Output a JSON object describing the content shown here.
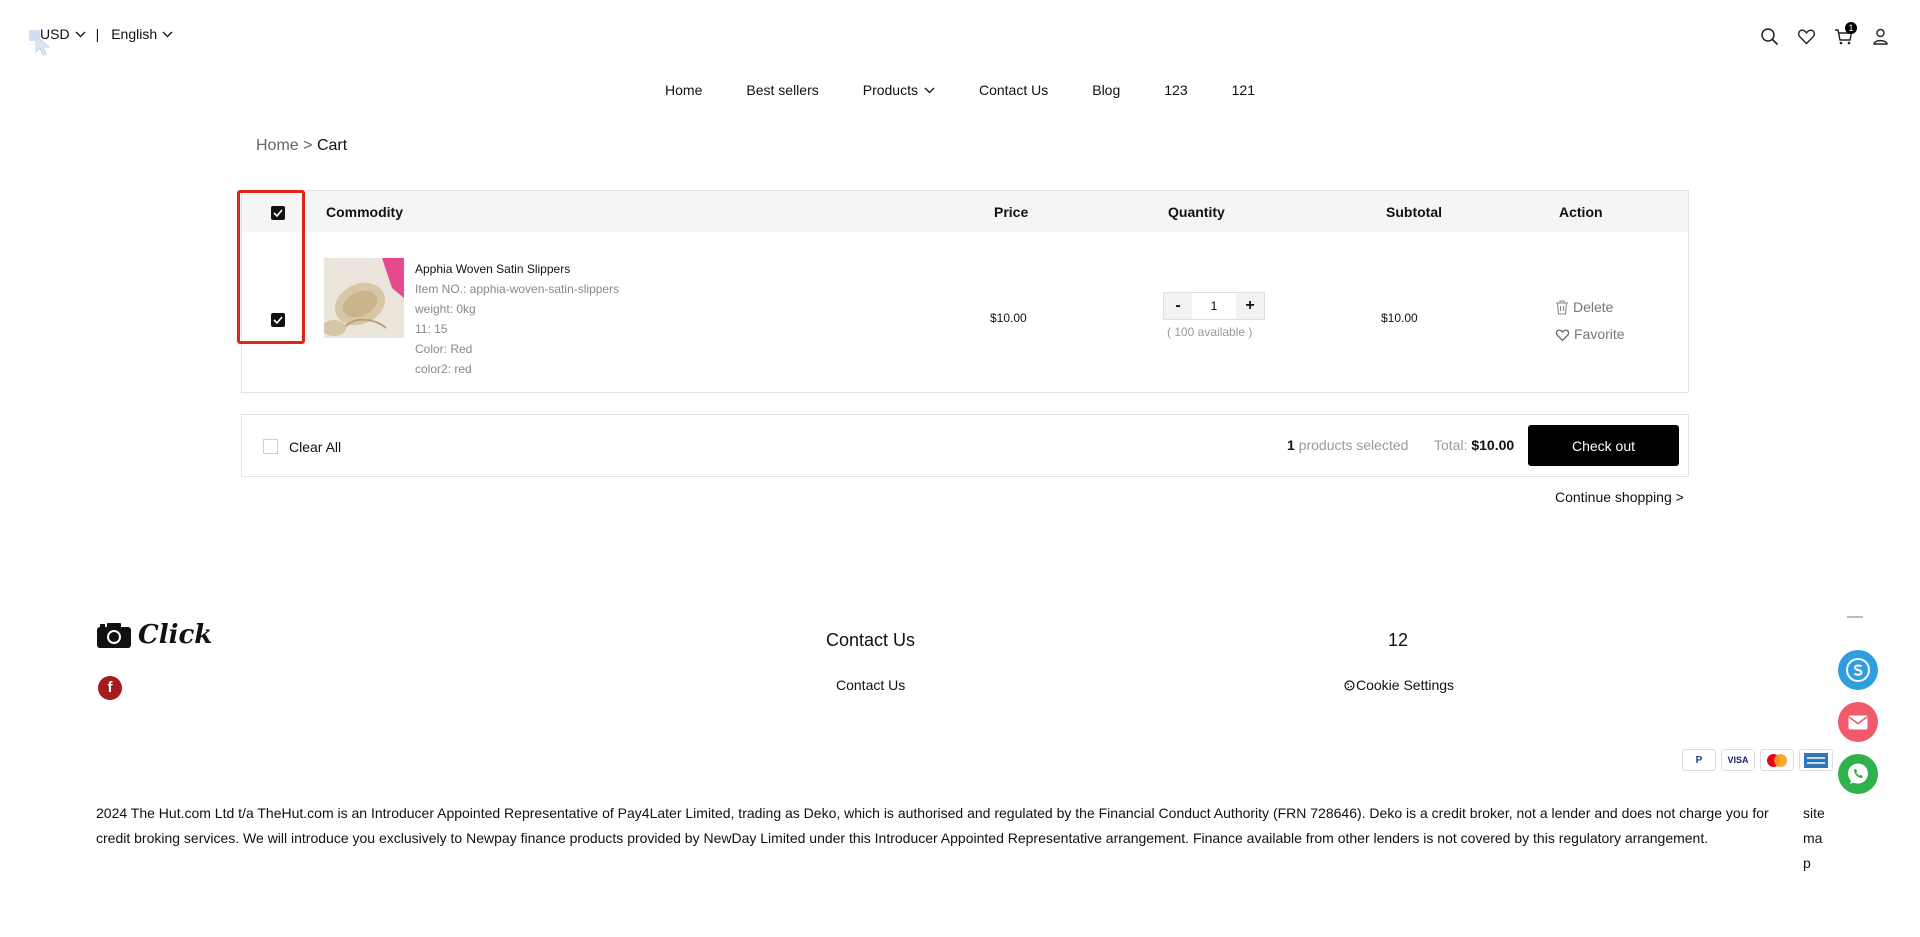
{
  "topbar": {
    "currency": "USD",
    "separator": "|",
    "language": "English",
    "cart_count": "1",
    "icons": [
      "search-icon",
      "heart-icon",
      "cart-icon",
      "user-icon"
    ]
  },
  "nav": {
    "items": [
      "Home",
      "Best sellers",
      "Products",
      "Contact Us",
      "Blog",
      "123",
      "121"
    ]
  },
  "breadcrumb": {
    "home": "Home",
    "sep": ">",
    "current": "Cart"
  },
  "cart": {
    "headers": {
      "commodity": "Commodity",
      "price": "Price",
      "quantity": "Quantity",
      "subtotal": "Subtotal",
      "action": "Action"
    },
    "select_all_checked": true,
    "items": [
      {
        "checked": true,
        "name": "Apphia Woven Satin Slippers",
        "item_no": "Item NO.: apphia-woven-satin-slippers",
        "weight": "weight: 0kg",
        "attr1": "11: 15",
        "color": "Color: Red",
        "color2": "color2: red",
        "price": "$10.00",
        "quantity": "1",
        "available": "( 100 available )",
        "subtotal": "$10.00",
        "delete_label": "Delete",
        "favorite_label": "Favorite"
      }
    ]
  },
  "summary": {
    "clear_all": "Clear All",
    "selected_count": "1",
    "selected_label": " products selected",
    "total_label": "Total:",
    "total_value": "$10.00",
    "checkout_label": "Check out"
  },
  "continue_label": "Continue shopping  >",
  "footer": {
    "logo_text": "Click",
    "col1_title": "Contact Us",
    "col1_link": "Contact Us",
    "col2_title": "12",
    "col2_link": "Cookie Settings",
    "payments": [
      "P",
      "VISA",
      "",
      ""
    ],
    "legal": "2024 The Hut.com Ltd t/a TheHut.com is an Introducer Appointed Representative of Pay4Later Limited, trading as Deko, which is authorised and regulated by the Financial Conduct Authority (FRN 728646). Deko is a credit broker, not a lender and does not charge you for credit broking services. We will introduce you exclusively to Newpay finance products provided by NewDay Limited under this Introducer Appointed Representative arrangement. Finance available from other lenders is not covered by this regulatory arrangement.",
    "sitemap": "site map"
  },
  "colors": {
    "skype": "#2f9ee0",
    "email": "#f05a6b",
    "whatsapp": "#2fb24c",
    "highlight": "#e2231a",
    "facebook": "#a51c1c"
  }
}
